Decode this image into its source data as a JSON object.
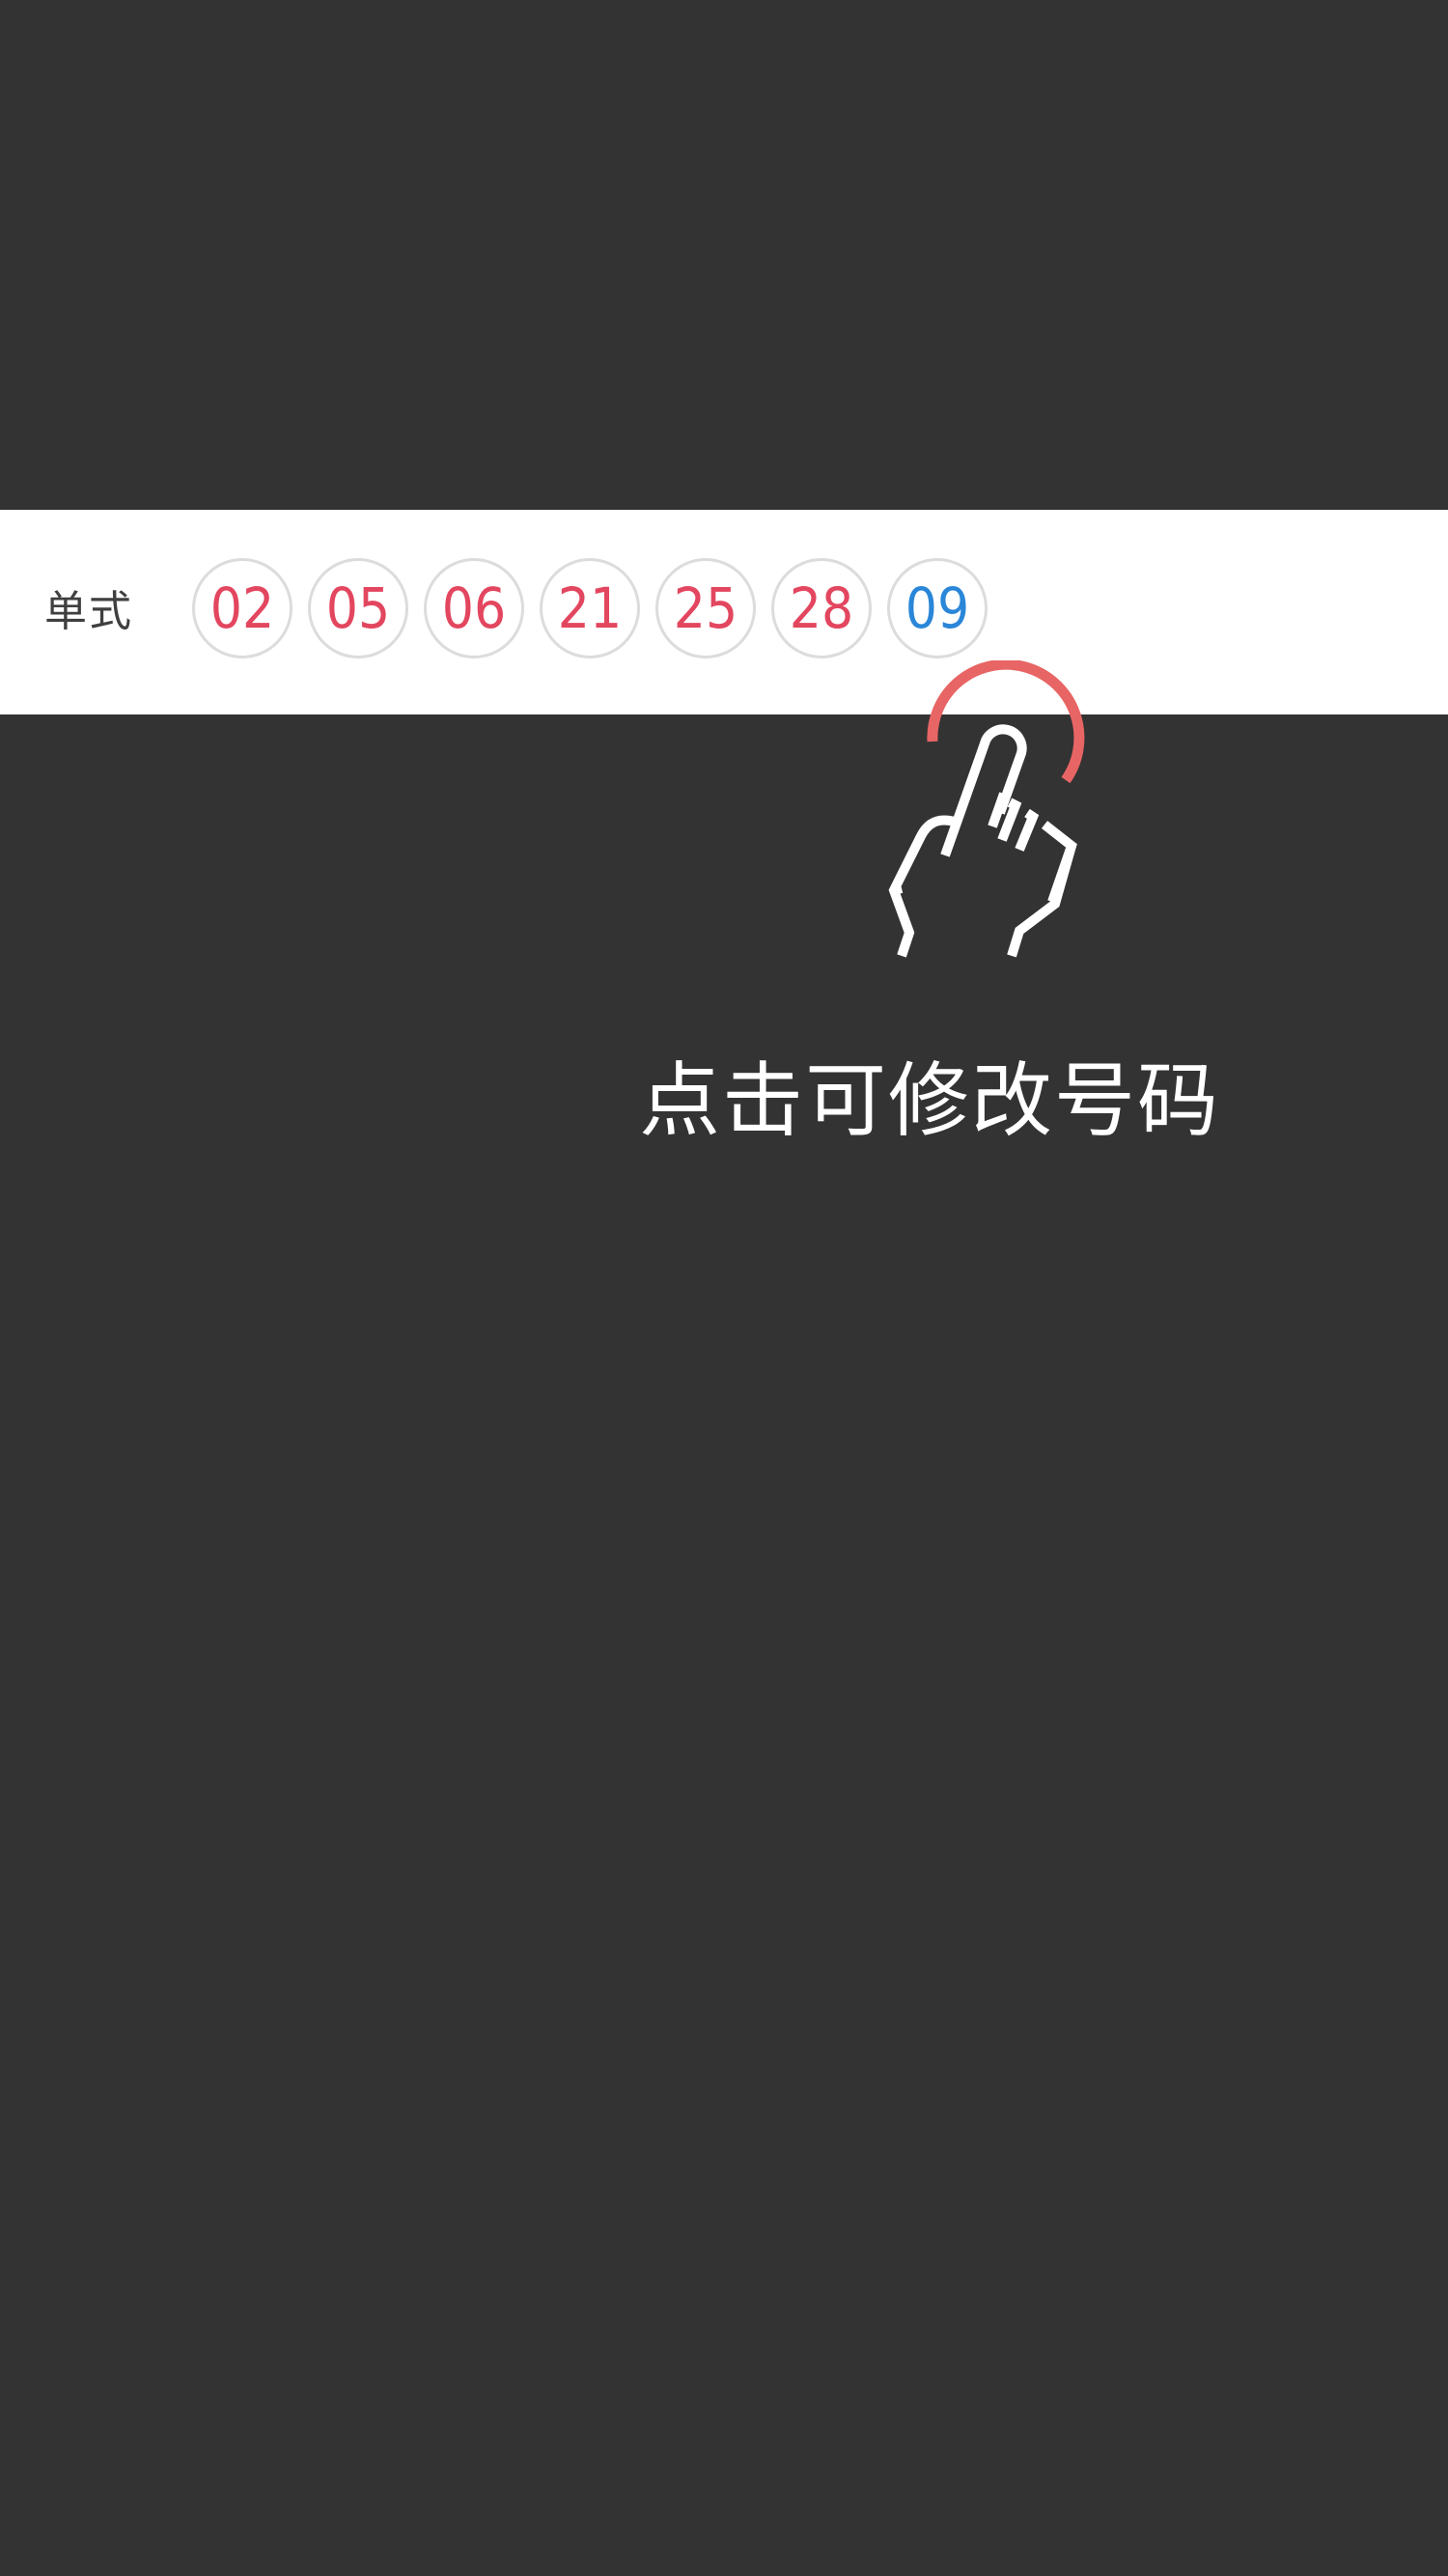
{
  "strip": {
    "label": "单式",
    "red_balls": [
      "02",
      "05",
      "06",
      "21",
      "25",
      "28"
    ],
    "blue_balls": [
      "09"
    ]
  },
  "hint": {
    "text": "点击可修改号码"
  },
  "colors": {
    "background": "#333333",
    "strip_background": "#ffffff",
    "red_ball": "#e3465f",
    "blue_ball": "#2a86d8",
    "ball_border": "#dcdcdc",
    "tap_arc": "#e86565",
    "hint_text": "#ffffff"
  },
  "icons": {
    "hand": "tap-hand-icon"
  }
}
